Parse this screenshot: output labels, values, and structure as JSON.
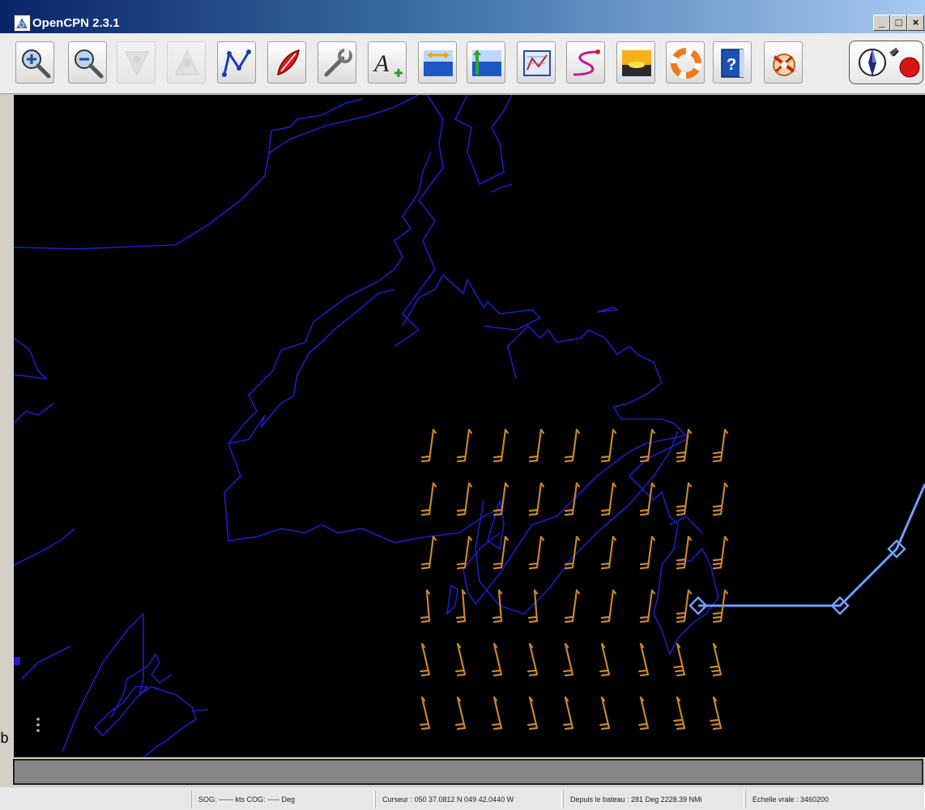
{
  "window": {
    "title": "OpenCPN 2.3.1",
    "controls": [
      "_",
      "□",
      "×"
    ]
  },
  "toolbar": {
    "buttons": [
      {
        "name": "zoom-in-button",
        "icon": "zoom-in-icon",
        "enabled": true
      },
      {
        "name": "zoom-out-button",
        "icon": "zoom-out-icon",
        "enabled": true
      },
      {
        "name": "scale-in-button",
        "icon": "scale-in-icon",
        "enabled": false
      },
      {
        "name": "scale-out-button",
        "icon": "scale-out-icon",
        "enabled": false
      },
      {
        "name": "route-button",
        "icon": "route-icon",
        "enabled": true
      },
      {
        "name": "follow-boat-button",
        "icon": "boat-icon",
        "enabled": true
      },
      {
        "name": "settings-button",
        "icon": "wrench-icon",
        "enabled": true
      },
      {
        "name": "text-button",
        "icon": "text-icon",
        "enabled": true
      },
      {
        "name": "currents-button",
        "icon": "currents-icon",
        "enabled": true
      },
      {
        "name": "tides-button",
        "icon": "tide-icon",
        "enabled": true
      },
      {
        "name": "route-manager-button",
        "icon": "route-manager-icon",
        "enabled": true
      },
      {
        "name": "track-button",
        "icon": "track-icon",
        "enabled": true
      },
      {
        "name": "color-scheme-button",
        "icon": "sunset-icon",
        "enabled": true
      },
      {
        "name": "mob-button",
        "icon": "lifebuoy-icon",
        "enabled": true
      },
      {
        "name": "help-button",
        "icon": "help-book-icon",
        "enabled": true
      },
      {
        "name": "grib-button",
        "icon": "grib-weather-icon",
        "enabled": true
      }
    ],
    "right": [
      "compass-icon",
      "gps-status-icon"
    ]
  },
  "chart": {
    "background": "#000000",
    "coastline_color": "#1c1cc8",
    "route_color": "#6f9fff",
    "wind_barb_color": "#c8862b"
  },
  "status": {
    "sog_cog": "SOG: ------ kts  COG: ----- Deg",
    "cursor": "Curseur : 050 37.0812 N 049 42.0440 W",
    "from_boat": "Depuis le bateau : 281 Deg  2228.39 NMi",
    "scale": "Echelle vrale :  3460200"
  },
  "left_margin_mark": "b"
}
